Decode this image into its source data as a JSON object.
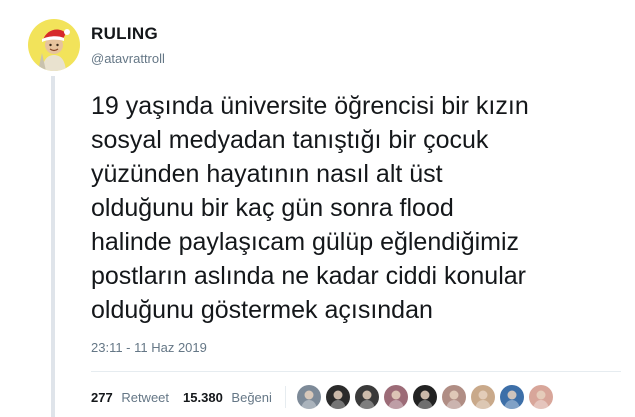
{
  "user": {
    "display_name": "RULING",
    "handle": "@atavrattroll",
    "avatar_icon": "profile-photo-santa-hat"
  },
  "tweet": {
    "lines": [
      "19 yaşında üniversite öğrencisi bir kızın",
      "sosyal medyadan tanıştığı bir çocuk",
      "yüzünden hayatının nasıl alt üst",
      "olduğunu bir kaç gün sonra flood",
      "halinde paylaşıcam gülüp eğlendiğimiz",
      "postların aslında ne kadar ciddi konular",
      "olduğunu göstermek açısından"
    ],
    "timestamp": "23:11 - 11 Haz 2019"
  },
  "stats": {
    "retweets_count": "277",
    "retweets_label": "Retweet",
    "likes_count": "15.380",
    "likes_label": "Beğeni"
  },
  "likers": [
    {
      "icon": "liker-avatar",
      "color": "#7d8a98"
    },
    {
      "icon": "liker-avatar",
      "color": "#2b2b2b"
    },
    {
      "icon": "liker-avatar",
      "color": "#3a3a3a"
    },
    {
      "icon": "liker-avatar",
      "color": "#9c6b77"
    },
    {
      "icon": "liker-avatar",
      "color": "#222222"
    },
    {
      "icon": "liker-avatar",
      "color": "#b08d84"
    },
    {
      "icon": "liker-avatar",
      "color": "#c9a98a"
    },
    {
      "icon": "liker-avatar",
      "color": "#3d6fa8"
    },
    {
      "icon": "liker-avatar",
      "color": "#d8a69a"
    }
  ],
  "colors": {
    "text_primary": "#14171a",
    "text_secondary": "#657786",
    "thread_line": "#dfe4ea",
    "avatar_background": "#f2e35a"
  }
}
